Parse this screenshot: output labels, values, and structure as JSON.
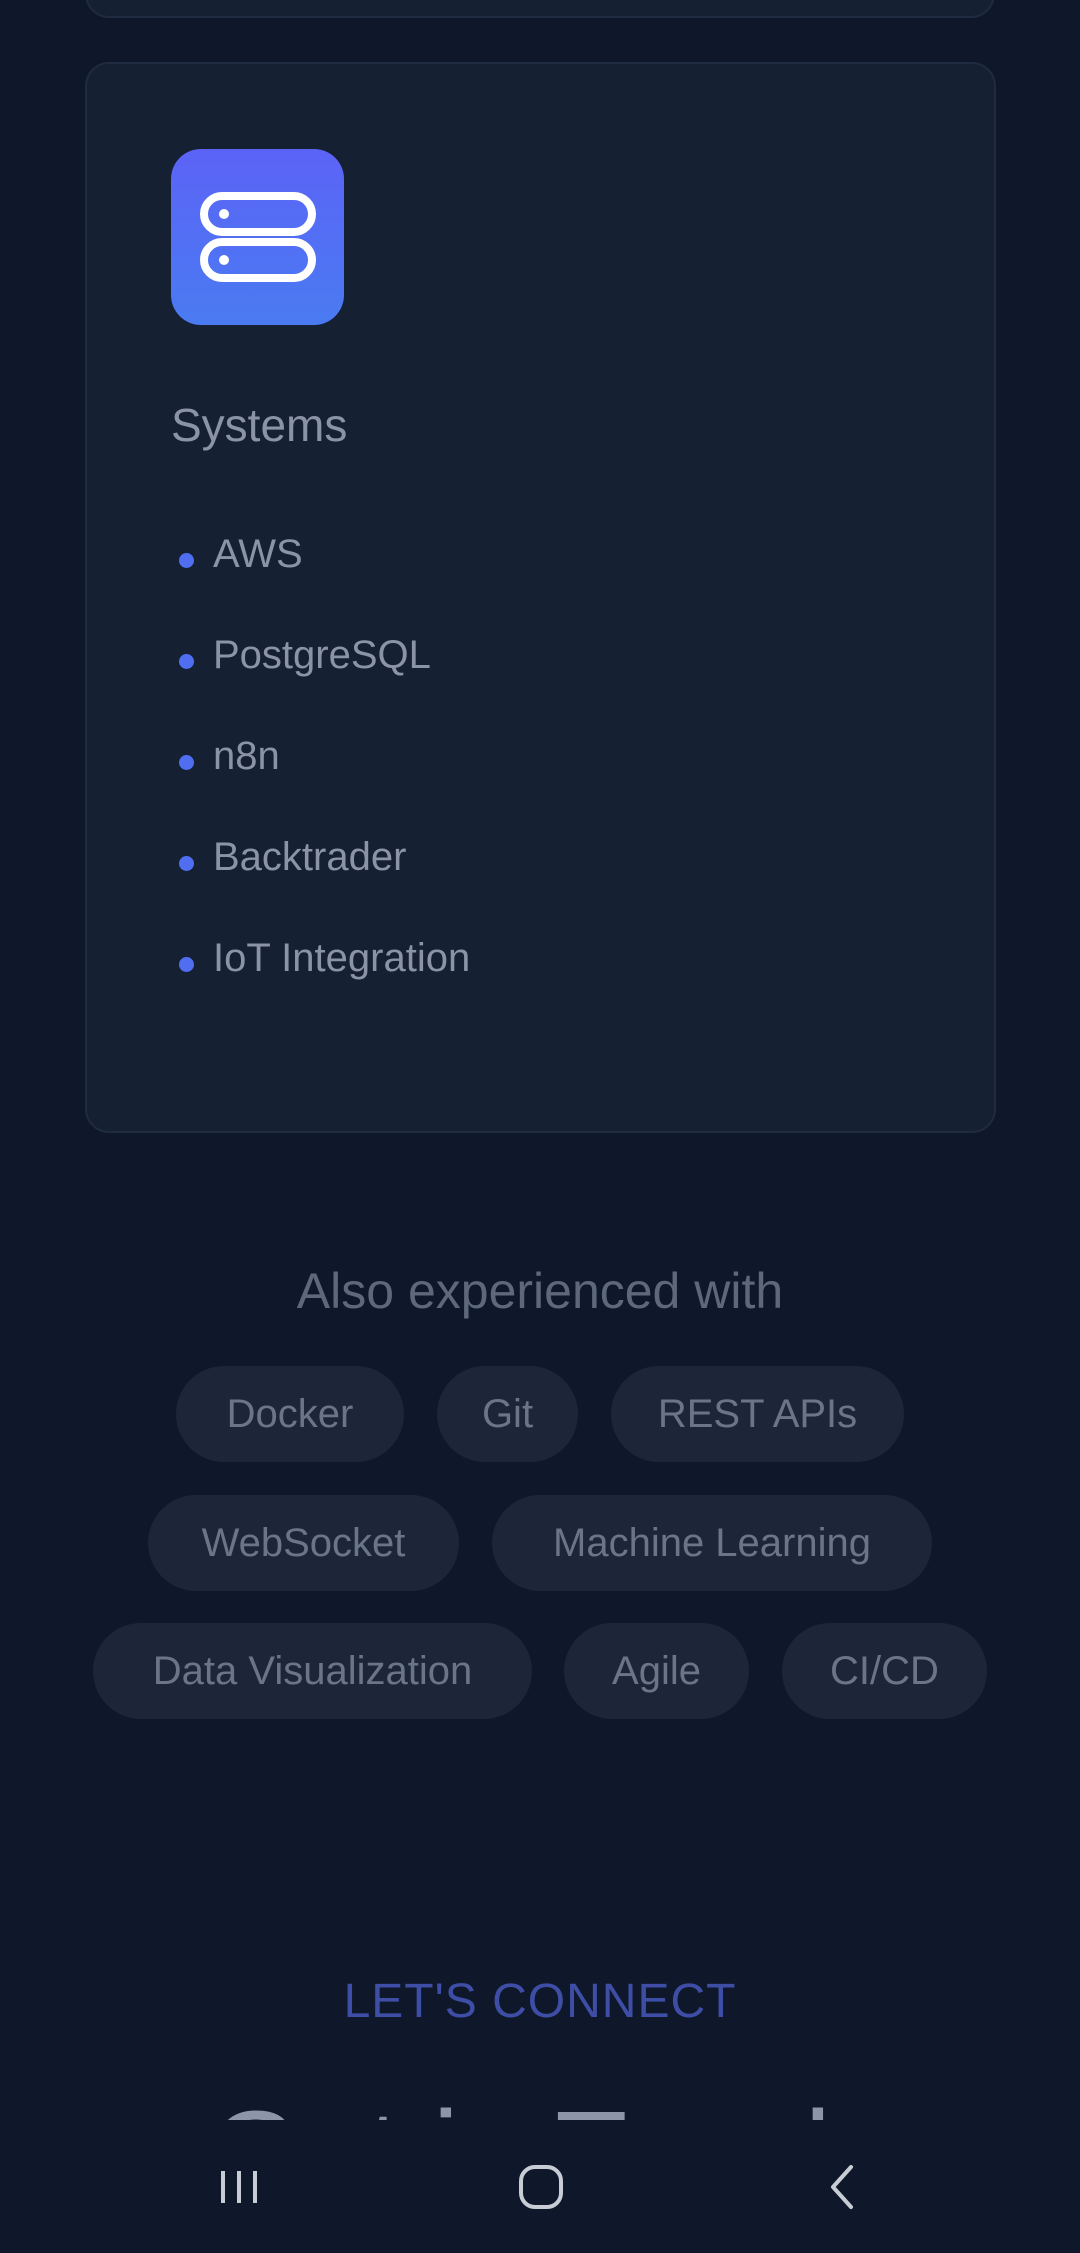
{
  "card": {
    "icon": "server-stack-icon",
    "title": "Systems",
    "items": [
      "AWS",
      "PostgreSQL",
      "n8n",
      "Backtrader",
      "IoT Integration"
    ]
  },
  "also": {
    "heading": "Also experienced with",
    "chips": [
      "Docker",
      "Git",
      "REST APIs",
      "WebSocket",
      "Machine Learning",
      "Data Visualization",
      "Agile",
      "CI/CD"
    ]
  },
  "connect": {
    "label": "LET'S CONNECT",
    "title": "Get in Touch"
  },
  "navbar": {
    "icons": [
      "recent-apps-icon",
      "home-icon",
      "back-icon"
    ]
  },
  "colors": {
    "background": "#0f172a",
    "card": "#162033",
    "accent": "#4f6ef0",
    "icon_gradient_start": "#5b63f6",
    "icon_gradient_end": "#4a7bf2",
    "connect_label": "#3e4ea6"
  }
}
